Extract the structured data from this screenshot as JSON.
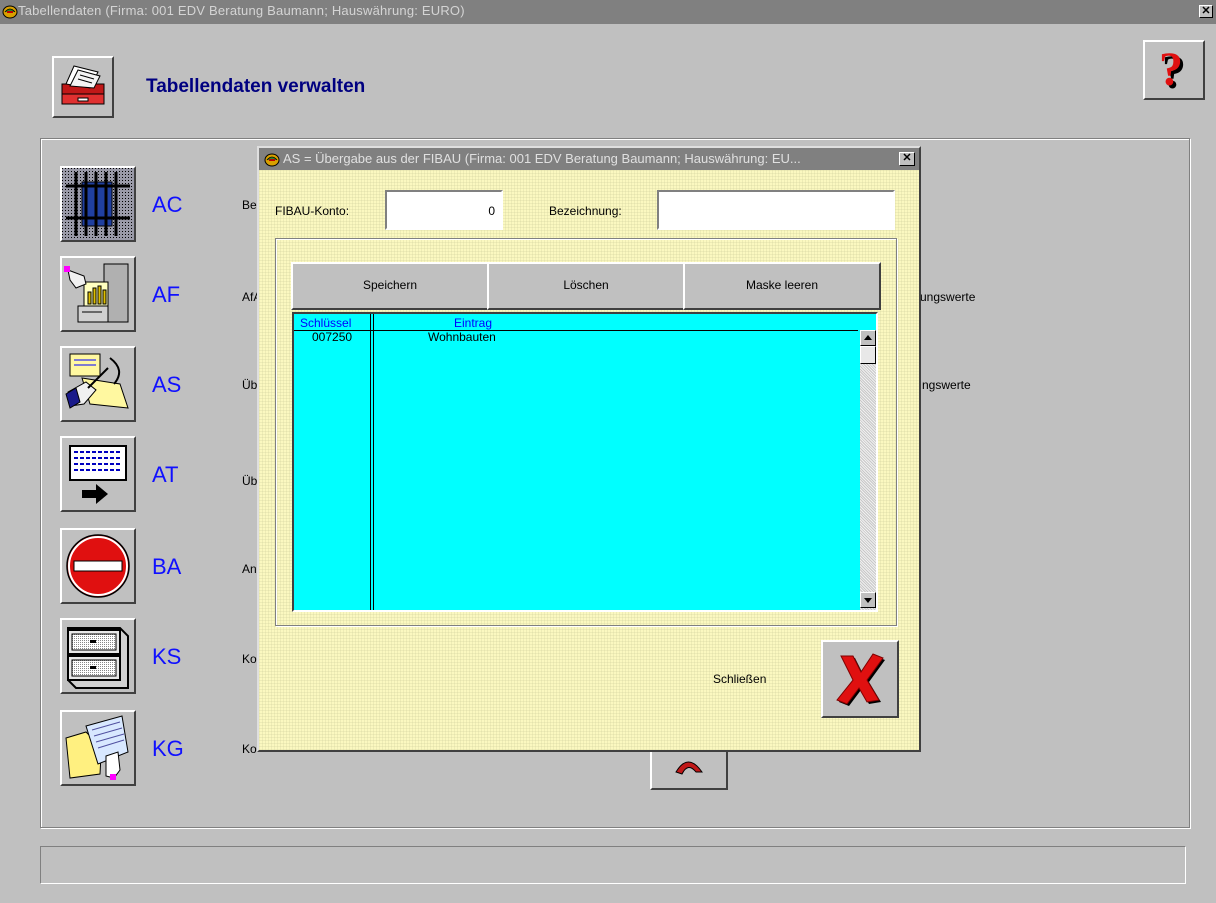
{
  "window": {
    "title": "Tabellendaten  (Firma: 001 EDV Beratung Baumann;   Hauswährung: EURO)",
    "close_glyph": "✕"
  },
  "header": {
    "title": "Tabellendaten verwalten",
    "help_glyph": "?"
  },
  "tables": [
    {
      "code": "AC",
      "desc": "Be",
      "icon": "jail-bars-icon"
    },
    {
      "code": "AF",
      "desc": "AfA",
      "icon": "chart-hand-icon"
    },
    {
      "code": "AS",
      "desc": "Üb",
      "icon": "writing-hand-icon"
    },
    {
      "code": "AT",
      "desc": "Üb",
      "icon": "text-arrow-icon"
    },
    {
      "code": "BA",
      "desc": "An",
      "icon": "no-entry-icon"
    },
    {
      "code": "KS",
      "desc": "Ko",
      "icon": "file-cabinet-icon"
    },
    {
      "code": "KG",
      "desc": "Ko",
      "icon": "folder-hand-icon"
    }
  ],
  "right_texts": {
    "af": "ungswerte",
    "as": "ngswerte"
  },
  "dialog": {
    "title": "AS = Übergabe aus der FIBAU  (Firma: 001 EDV Beratung Baumann;   Hauswährung: EU...",
    "close_glyph": "✕",
    "fibau_label": "FIBAU-Konto:",
    "fibau_value": "0",
    "bezeichnung_label": "Bezeichnung:",
    "bezeichnung_value": "",
    "buttons": {
      "save": "Speichern",
      "delete": "Löschen",
      "clear": "Maske leeren"
    },
    "grid": {
      "columns": [
        "Schlüssel",
        "Eintrag"
      ],
      "rows": [
        {
          "key": "007250",
          "entry": "Wohnbauten"
        }
      ]
    },
    "close_label": "Schließen",
    "close_glyph_big": "✘"
  },
  "statusbar": {
    "text": ""
  },
  "colors": {
    "grid_bg": "#00ffff",
    "grid_header_text": "#0000ff",
    "code_label": "#1010ff",
    "title_blue": "#000080"
  }
}
